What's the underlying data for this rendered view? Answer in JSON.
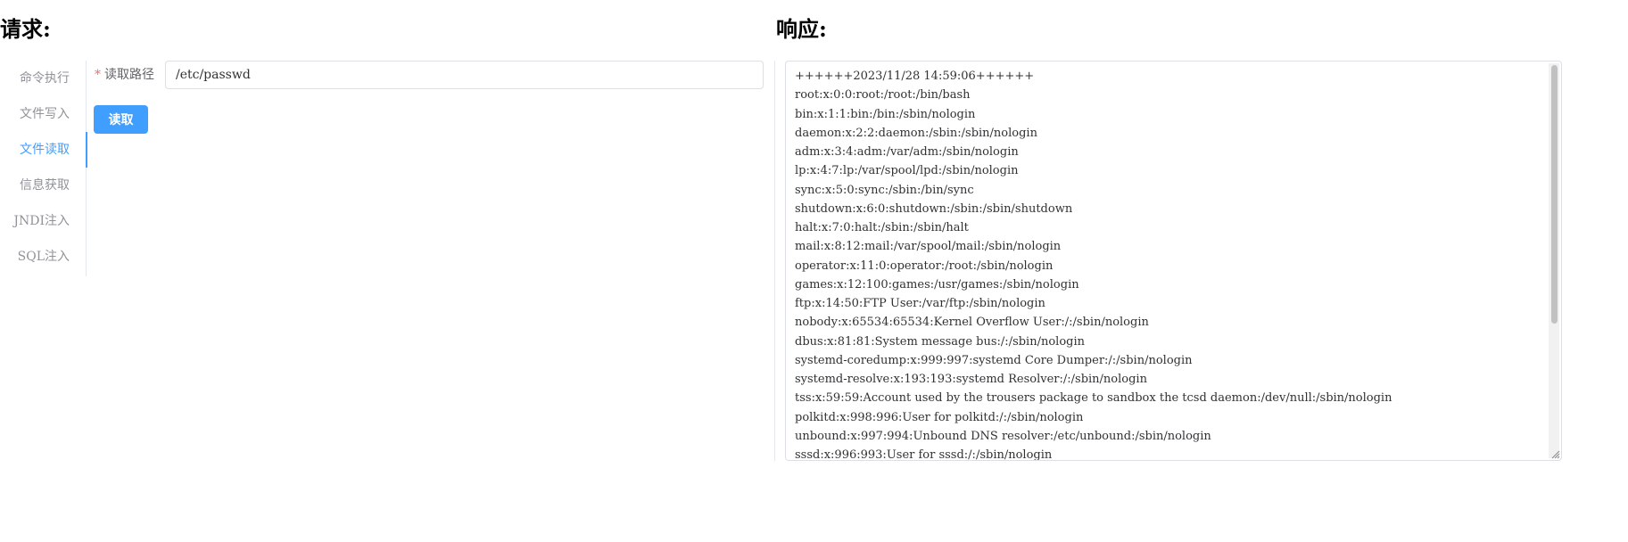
{
  "request": {
    "title": "请求:",
    "tabs": [
      {
        "label": "命令执行",
        "active": false
      },
      {
        "label": "文件写入",
        "active": false
      },
      {
        "label": "文件读取",
        "active": true
      },
      {
        "label": "信息获取",
        "active": false
      },
      {
        "label": "JNDI注入",
        "active": false
      },
      {
        "label": "SQL注入",
        "active": false
      }
    ],
    "form": {
      "required_mark": "*",
      "path_label": "读取路径",
      "path_value": "/etc/passwd",
      "submit_label": "读取"
    }
  },
  "response": {
    "title": "响应:",
    "lines": [
      "++++++2023/11/28 14:59:06++++++",
      "root:x:0:0:root:/root:/bin/bash",
      "bin:x:1:1:bin:/bin:/sbin/nologin",
      "daemon:x:2:2:daemon:/sbin:/sbin/nologin",
      "adm:x:3:4:adm:/var/adm:/sbin/nologin",
      "lp:x:4:7:lp:/var/spool/lpd:/sbin/nologin",
      "sync:x:5:0:sync:/sbin:/bin/sync",
      "shutdown:x:6:0:shutdown:/sbin:/sbin/shutdown",
      "halt:x:7:0:halt:/sbin:/sbin/halt",
      "mail:x:8:12:mail:/var/spool/mail:/sbin/nologin",
      "operator:x:11:0:operator:/root:/sbin/nologin",
      "games:x:12:100:games:/usr/games:/sbin/nologin",
      "ftp:x:14:50:FTP User:/var/ftp:/sbin/nologin",
      "nobody:x:65534:65534:Kernel Overflow User:/:/sbin/nologin",
      "dbus:x:81:81:System message bus:/:/sbin/nologin",
      "systemd-coredump:x:999:997:systemd Core Dumper:/:/sbin/nologin",
      "systemd-resolve:x:193:193:systemd Resolver:/:/sbin/nologin",
      "tss:x:59:59:Account used by the trousers package to sandbox the tcsd daemon:/dev/null:/sbin/nologin",
      "polkitd:x:998:996:User for polkitd:/:/sbin/nologin",
      "unbound:x:997:994:Unbound DNS resolver:/etc/unbound:/sbin/nologin",
      "sssd:x:996:993:User for sssd:/:/sbin/nologin"
    ]
  },
  "colors": {
    "accent": "#409eff",
    "required": "#f56c6c",
    "tab_inactive": "#909399",
    "border": "#dcdfe6"
  }
}
